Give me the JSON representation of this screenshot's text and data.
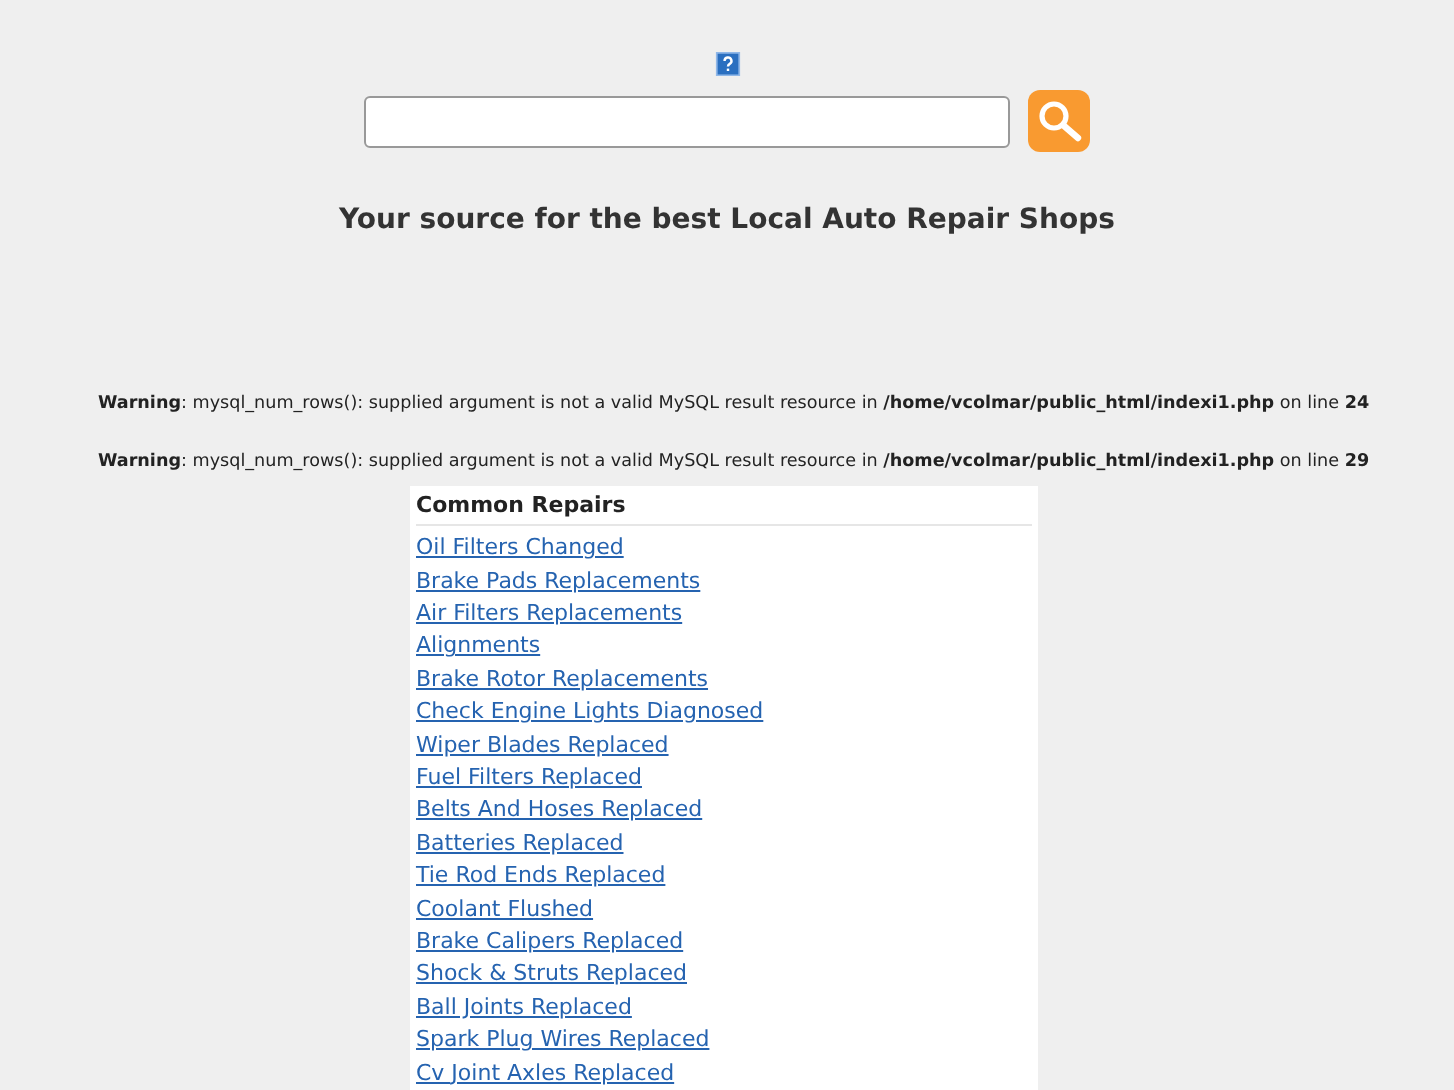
{
  "tagline": "Your source for the best Local Auto Repair Shops",
  "warnings": [
    "**Warning**: mysql_num_rows(): supplied argument is not a valid MySQL result resource in **/home/vcolmar/public_html/indexi1.php** on line **24**",
    "**Warning**: mysql_num_rows(): supplied argument is not a valid MySQL result resource in **/home/vcolmar/public_html/indexi1.php** on line **29**"
  ],
  "common_repairs": {
    "title": "Common Repairs",
    "links": [
      "Oil Filters Changed",
      "Brake Pads Replacements",
      "Air Filters Replacements",
      "Alignments",
      "Brake Rotor Replacements",
      "Check Engine Lights Diagnosed",
      "Wiper Blades Replaced",
      "Fuel Filters Replaced",
      "Belts And Hoses Replaced",
      "Batteries Replaced",
      "Tie Rod Ends Replaced",
      "Coolant Flushed",
      "Brake Calipers Replaced",
      "Shock & Struts Replaced",
      "Ball Joints Replaced",
      "Spark Plug Wires Replaced",
      "Cv Joint Axles Replaced"
    ]
  }
}
